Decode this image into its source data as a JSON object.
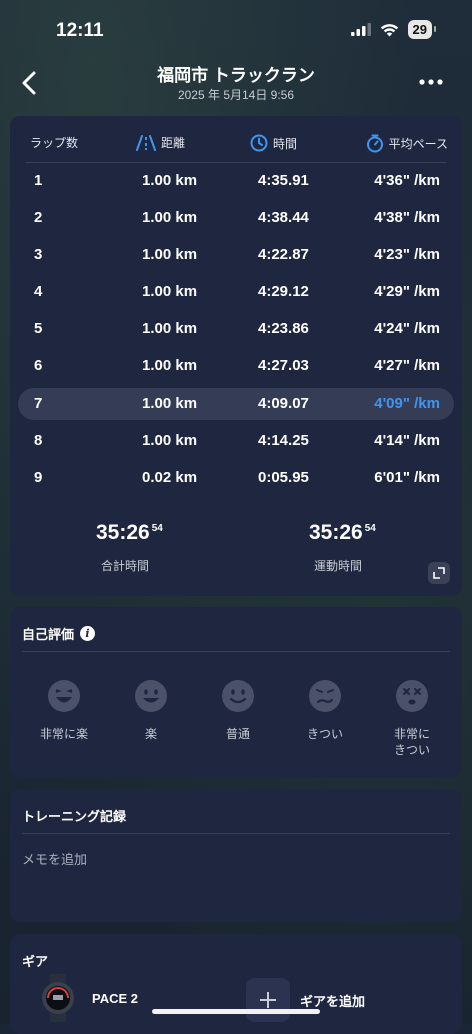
{
  "status": {
    "time": "12:11",
    "battery": "29"
  },
  "header": {
    "title": "福岡市 トラックラン",
    "subtitle": "2025 年 5月14日 9:56"
  },
  "laps": {
    "headers": {
      "lap": "ラップ数",
      "distance": "距離",
      "time": "時間",
      "pace": "平均ペース"
    },
    "rows": [
      {
        "lap": "1",
        "distance": "1.00 km",
        "time": "4:35.91",
        "pace": "4'36\" /km"
      },
      {
        "lap": "2",
        "distance": "1.00 km",
        "time": "4:38.44",
        "pace": "4'38\" /km"
      },
      {
        "lap": "3",
        "distance": "1.00 km",
        "time": "4:22.87",
        "pace": "4'23\" /km"
      },
      {
        "lap": "4",
        "distance": "1.00 km",
        "time": "4:29.12",
        "pace": "4'29\" /km"
      },
      {
        "lap": "5",
        "distance": "1.00 km",
        "time": "4:23.86",
        "pace": "4'24\" /km"
      },
      {
        "lap": "6",
        "distance": "1.00 km",
        "time": "4:27.03",
        "pace": "4'27\" /km"
      },
      {
        "lap": "7",
        "distance": "1.00 km",
        "time": "4:09.07",
        "pace": "4'09\" /km"
      },
      {
        "lap": "8",
        "distance": "1.00 km",
        "time": "4:14.25",
        "pace": "4'14\" /km"
      },
      {
        "lap": "9",
        "distance": "0.02 km",
        "time": "0:05.95",
        "pace": "6'01\" /km"
      }
    ],
    "highlighted_lap": "7",
    "totals": {
      "total_time": {
        "main": "35:26",
        "sub": "54",
        "label": "合計時間"
      },
      "moving_time": {
        "main": "35:26",
        "sub": "54",
        "label": "運動時間"
      }
    }
  },
  "self_eval": {
    "title": "自己評価",
    "options": [
      {
        "label": "非常に楽",
        "icon": "laughing-face-icon"
      },
      {
        "label": "楽",
        "icon": "grinning-face-icon"
      },
      {
        "label": "普通",
        "icon": "smiling-face-icon"
      },
      {
        "label": "きつい",
        "icon": "grimacing-face-icon"
      },
      {
        "label_line1": "非常に",
        "label_line2": "きつい",
        "icon": "dizzy-face-icon"
      }
    ]
  },
  "training": {
    "title": "トレーニング記録",
    "memo_placeholder": "メモを追加"
  },
  "gear": {
    "title": "ギア",
    "device_name": "PACE 2",
    "add_label": "ギアを追加"
  },
  "colors": {
    "accent": "#3d96f0",
    "card": "#1f2640",
    "background": "#1a2535"
  }
}
